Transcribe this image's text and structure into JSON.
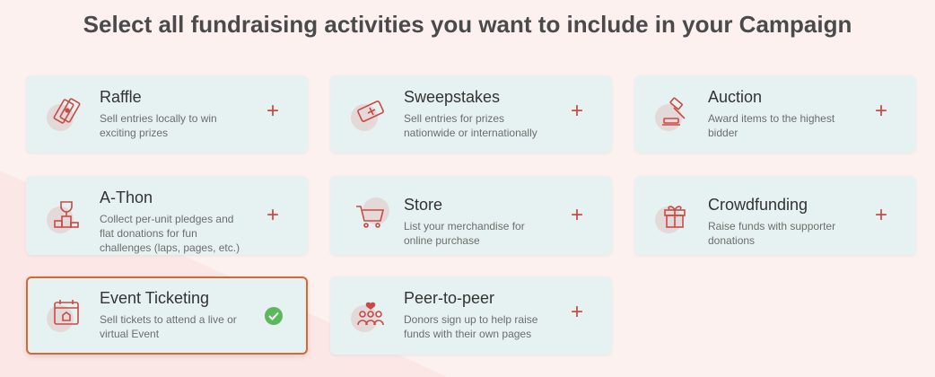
{
  "page": {
    "title": "Select all fundraising activities you want to include in your Campaign"
  },
  "colors": {
    "accent": "#c94a45",
    "selected_border": "#d16a36",
    "check": "#5cb85c",
    "card_bg": "#e6f2f1"
  },
  "activities": [
    {
      "title": "Raffle",
      "description": "Sell entries locally to win exciting prizes",
      "icon": "raffle-ticket-icon",
      "action": "+",
      "selected": false
    },
    {
      "title": "Sweepstakes",
      "description": "Sell entries for prizes nationwide or internationally",
      "icon": "sweepstakes-ticket-icon",
      "action": "+",
      "selected": false
    },
    {
      "title": "Auction",
      "description": "Award items to the highest bidder",
      "icon": "gavel-icon",
      "action": "+",
      "selected": false
    },
    {
      "title": "A-Thon",
      "description": "Collect per-unit pledges and flat donations for fun challenges (laps, pages, etc.)",
      "icon": "trophy-podium-icon",
      "action": "+",
      "selected": false
    },
    {
      "title": "Store",
      "description": "List your merchandise for online purchase",
      "icon": "shopping-cart-icon",
      "action": "+",
      "selected": false
    },
    {
      "title": "Crowdfunding",
      "description": "Raise funds with supporter donations",
      "icon": "gift-box-icon",
      "action": "+",
      "selected": false
    },
    {
      "title": "Event Ticketing",
      "description": "Sell tickets to attend a live or virtual Event",
      "icon": "event-calendar-icon",
      "action": "check",
      "selected": true
    },
    {
      "title": "Peer-to-peer",
      "description": "Donors sign up to help raise funds with their own pages",
      "icon": "people-heart-icon",
      "action": "+",
      "selected": false
    }
  ]
}
